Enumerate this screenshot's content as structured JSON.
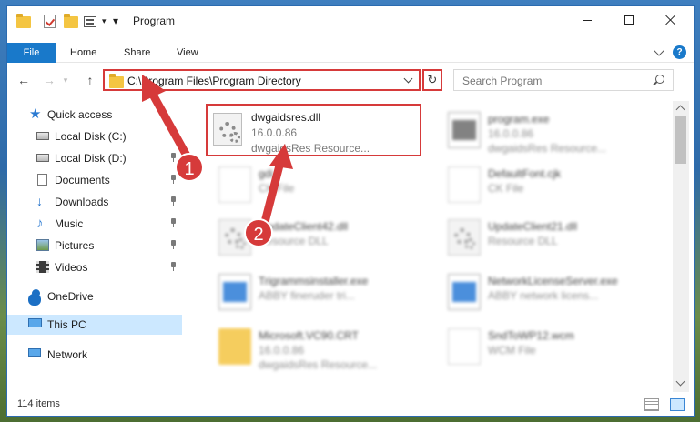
{
  "window": {
    "title": "Program"
  },
  "ribbon": {
    "tabs": [
      "File",
      "Home",
      "Share",
      "View"
    ],
    "help_label": "?"
  },
  "address_bar": {
    "path": "C:\\Program Files\\Program Directory",
    "refresh_glyph": "↻"
  },
  "search": {
    "placeholder": "Search Program"
  },
  "nav_glyphs": {
    "back": "←",
    "forward": "→",
    "up": "↑"
  },
  "sidebar": {
    "items": [
      {
        "label": "Quick access",
        "icon": "star-icon"
      },
      {
        "label": "Local Disk (C:)",
        "icon": "disk-icon",
        "pinned": false
      },
      {
        "label": "Local Disk (D:)",
        "icon": "disk-icon",
        "pinned": true
      },
      {
        "label": "Documents",
        "icon": "documents-icon",
        "pinned": true
      },
      {
        "label": "Downloads",
        "icon": "downloads-icon",
        "pinned": true
      },
      {
        "label": "Music",
        "icon": "music-icon",
        "pinned": true
      },
      {
        "label": "Pictures",
        "icon": "pictures-icon",
        "pinned": true
      },
      {
        "label": "Videos",
        "icon": "videos-icon",
        "pinned": true
      },
      {
        "label": "OneDrive",
        "icon": "onedrive-icon"
      },
      {
        "label": "This PC",
        "icon": "this-pc-icon",
        "selected": true
      },
      {
        "label": "Network",
        "icon": "network-icon"
      }
    ]
  },
  "files": [
    {
      "name": "dwgaidsres.dll",
      "line2": "16.0.0.86",
      "line3": "dwgaidsRes Resource...",
      "icon": "dll-icon",
      "highlighted": true
    },
    {
      "name": "program.exe",
      "line2": "16.0.0.86",
      "line3": "dwgaidsRes Resource...",
      "icon": "exe-icon"
    },
    {
      "name": "gdi",
      "line2": "CK File",
      "icon": "page-icon"
    },
    {
      "name": "DefaultFont.cjk",
      "line2": "CK File",
      "icon": "page-icon"
    },
    {
      "name": "UpdateClient42.dll",
      "line2": "Resource DLL",
      "icon": "dll-icon"
    },
    {
      "name": "UpdateClient21.dll",
      "line2": "Resource DLL",
      "icon": "dll-icon"
    },
    {
      "name": "Trigrammsinstaller.exe",
      "line2": "ABBY fineruder tri...",
      "icon": "exe-icon"
    },
    {
      "name": "NetworkLicenseServer.exe",
      "line2": "ABBY network licens...",
      "icon": "exe-icon"
    },
    {
      "name": "Microsoft.VC90.CRT",
      "line2": "16.0.0.86",
      "line3": "dwgaidsRes Resource...",
      "icon": "folder-icon"
    },
    {
      "name": "SndToWP12.wcm",
      "line2": "WCM File",
      "icon": "page-icon"
    }
  ],
  "status": {
    "item_count": "114 items"
  },
  "callouts": {
    "one": "1",
    "two": "2"
  },
  "colors": {
    "accent": "#1979ca",
    "highlight_red": "#d63a3a",
    "selected_bg": "#cce8ff"
  }
}
